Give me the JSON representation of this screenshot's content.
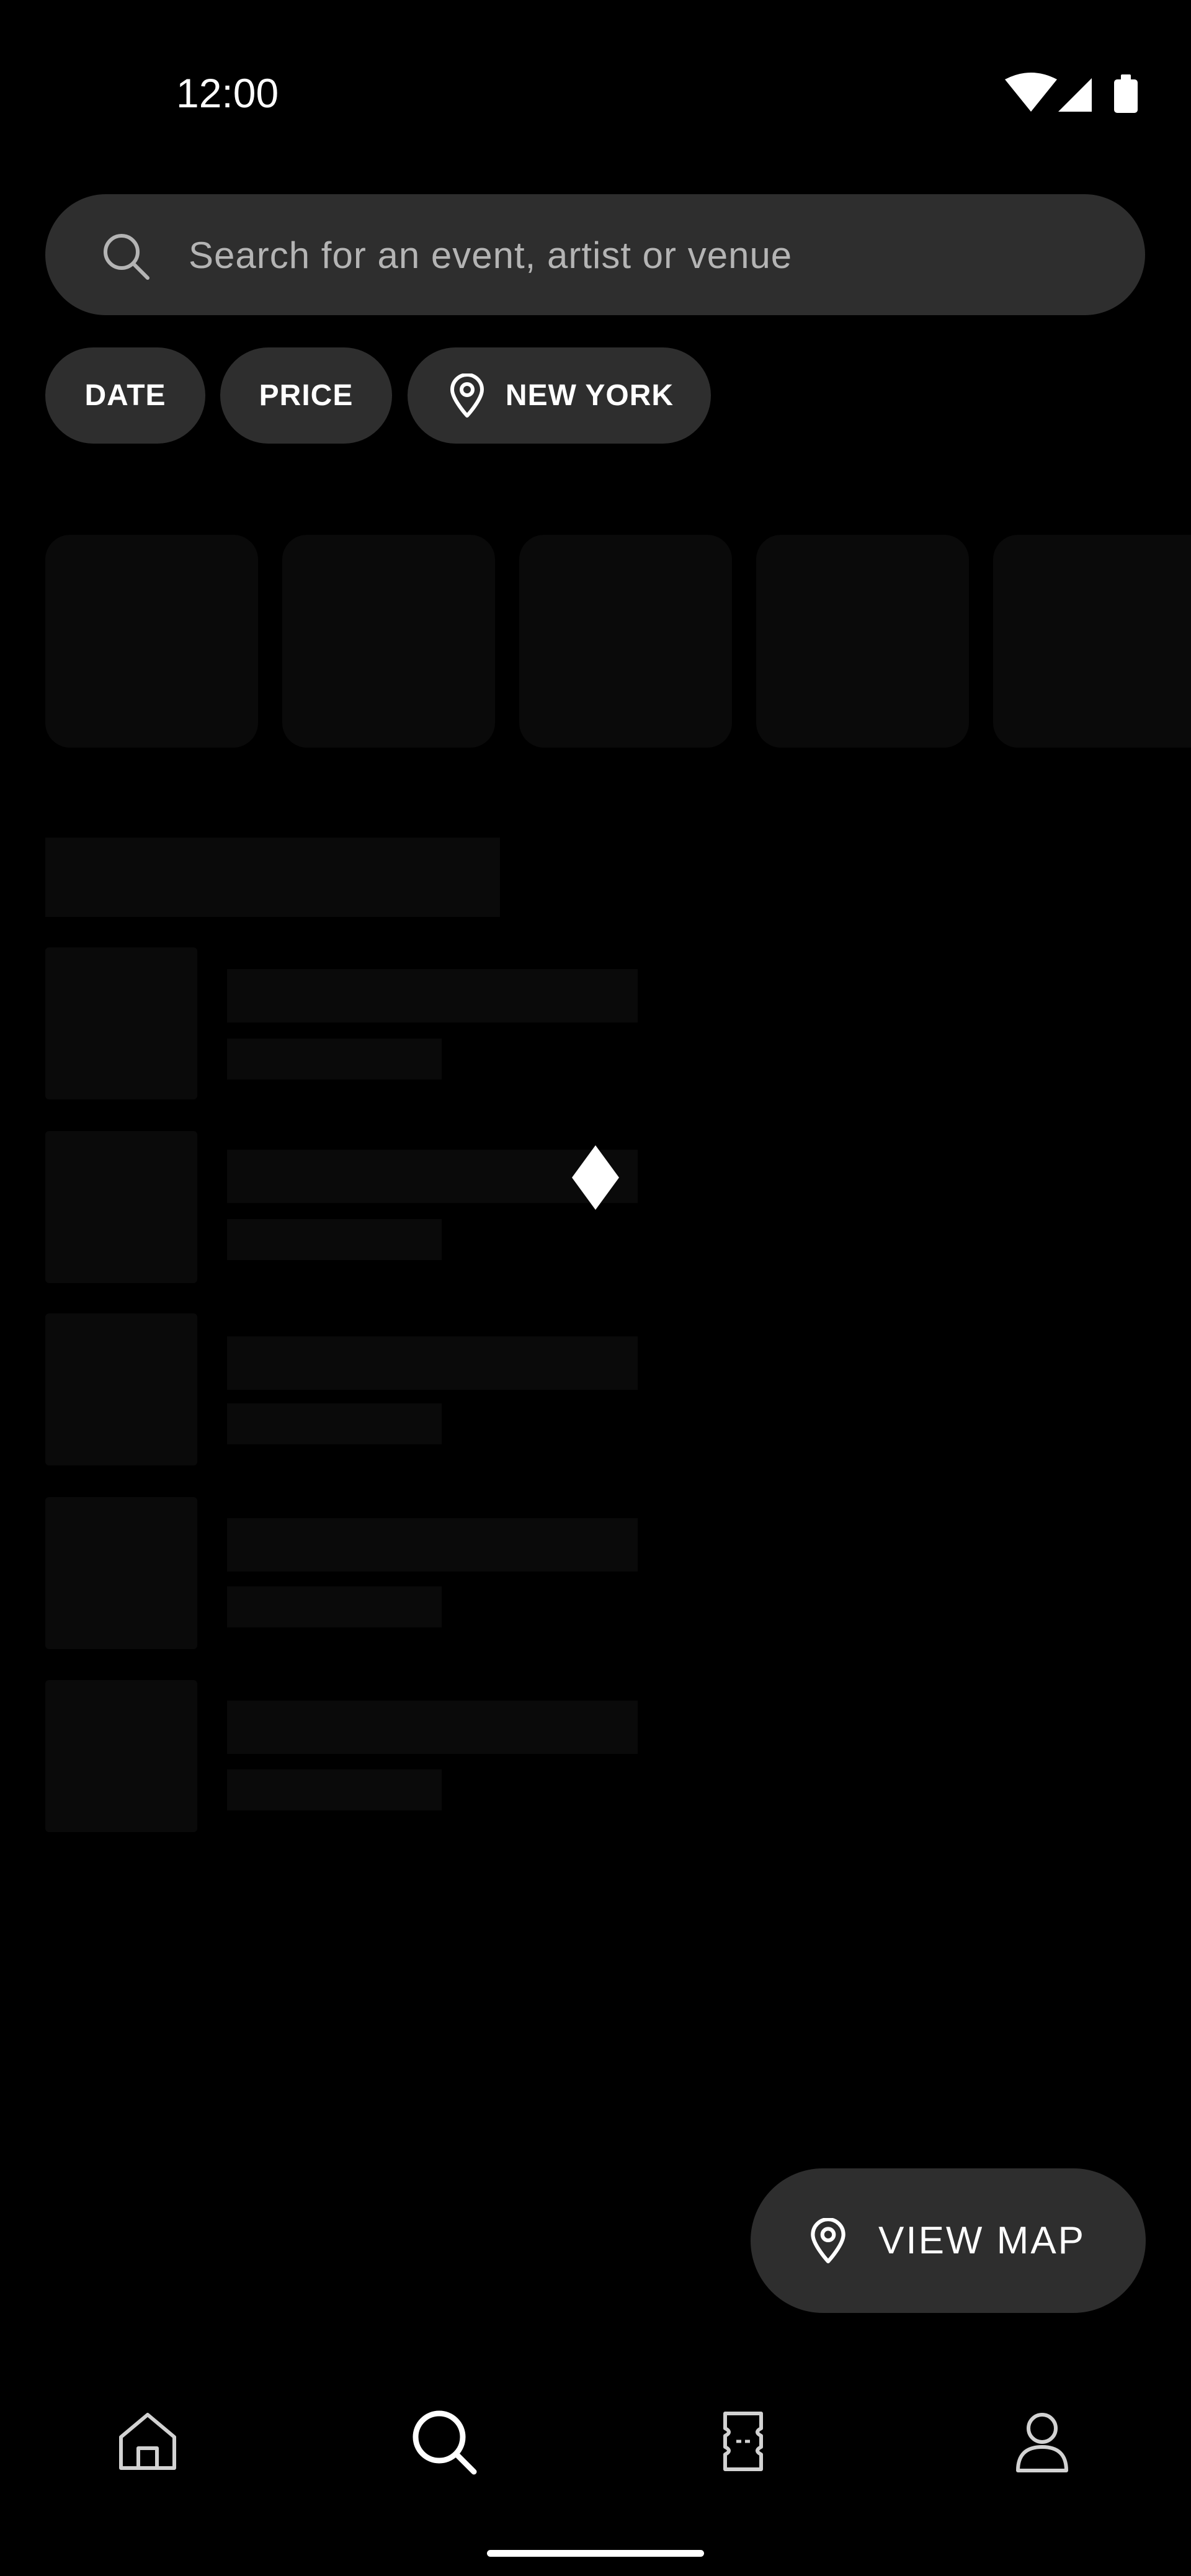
{
  "status_bar": {
    "time": "12:00",
    "icons": [
      "wifi-icon",
      "signal-icon",
      "battery-icon"
    ]
  },
  "search": {
    "placeholder": "Search for an event, artist or venue",
    "icon": "search-icon"
  },
  "filters": {
    "date_label": "DATE",
    "price_label": "PRICE",
    "location_label": "NEW YORK",
    "location_icon": "location-pin-icon"
  },
  "loading": {
    "indicator": "diamond-spinner"
  },
  "view_map": {
    "label": "VIEW MAP",
    "icon": "location-pin-icon"
  },
  "bottom_nav": {
    "items": [
      {
        "icon": "home-icon",
        "active": false
      },
      {
        "icon": "search-icon",
        "active": true
      },
      {
        "icon": "ticket-icon",
        "active": false
      },
      {
        "icon": "profile-icon",
        "active": false
      }
    ]
  },
  "colors": {
    "background": "#000000",
    "surface": "#2e2e2e",
    "skeleton": "#0a0a0a",
    "text_primary": "#ffffff",
    "text_secondary": "#b4b4b4"
  }
}
